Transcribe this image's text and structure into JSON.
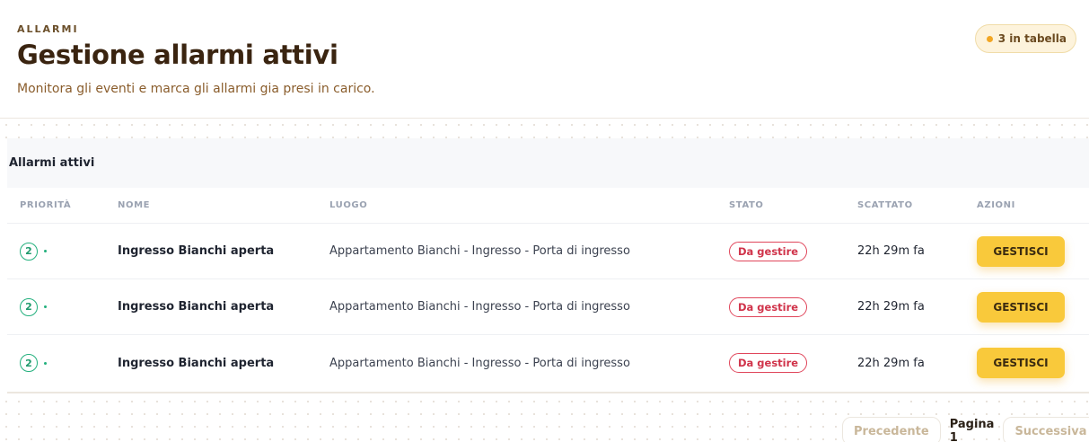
{
  "header": {
    "eyebrow": "ALLARMI",
    "title": "Gestione allarmi attivi",
    "subtitle": "Monitora gli eventi e marca gli allarmi gia presi in carico.",
    "count_badge": "3 in tabella"
  },
  "card": {
    "title": "Allarmi attivi",
    "columns": [
      "PRIORITÀ",
      "NOME",
      "LUOGO",
      "STATO",
      "SCATTATO",
      "AZIONI"
    ],
    "rows": [
      {
        "priority": "2",
        "name": "Ingresso Bianchi aperta",
        "place": "Appartamento Bianchi - Ingresso - Porta di ingresso",
        "state": "Da gestire",
        "time": "22h 29m fa",
        "action": "GESTISCI"
      },
      {
        "priority": "2",
        "name": "Ingresso Bianchi aperta",
        "place": "Appartamento Bianchi - Ingresso - Porta di ingresso",
        "state": "Da gestire",
        "time": "22h 29m fa",
        "action": "GESTISCI"
      },
      {
        "priority": "2",
        "name": "Ingresso Bianchi aperta",
        "place": "Appartamento Bianchi - Ingresso - Porta di ingresso",
        "state": "Da gestire",
        "time": "22h 29m fa",
        "action": "GESTISCI"
      }
    ]
  },
  "pager": {
    "prev": "Precedente",
    "page": "Pagina 1",
    "next": "Successiva"
  },
  "colors": {
    "accent": "#f9c93b",
    "priority": "#23b07d",
    "state_alert": "#e0465b",
    "title": "#3a2410"
  }
}
